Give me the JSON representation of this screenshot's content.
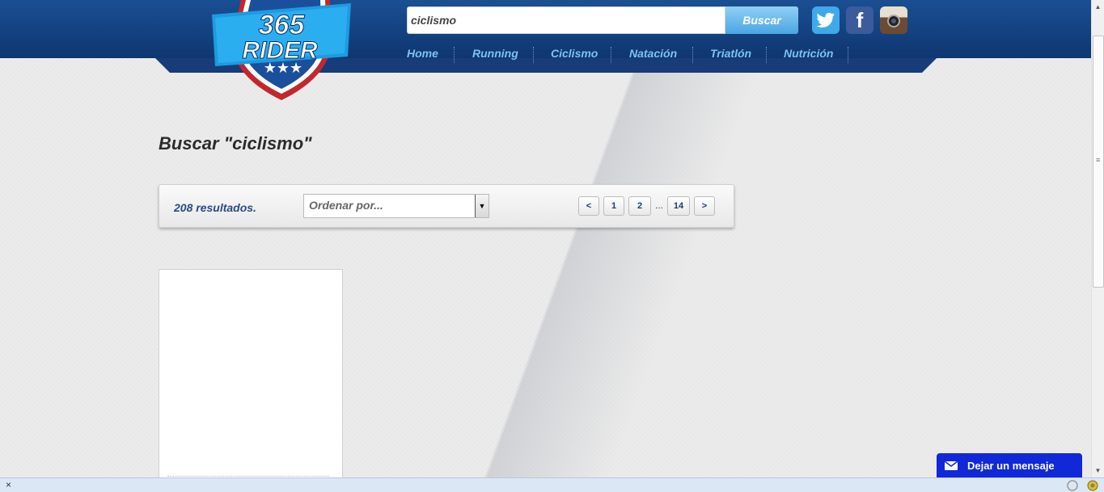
{
  "header": {
    "logo_line1": "365",
    "logo_line2": "RIDER",
    "search_value": "ciclismo",
    "search_button": "Buscar",
    "nav": [
      "Home",
      "Running",
      "Ciclismo",
      "Natación",
      "Triatlón",
      "Nutrición"
    ],
    "social": [
      "twitter-icon",
      "facebook-icon",
      "instagram-icon"
    ],
    "colors": {
      "header": "#0f3670",
      "nav_text": "#7fc2f0",
      "button": "#4aa6e3"
    }
  },
  "main": {
    "title": "Buscar \"ciclismo\"",
    "results": "208 resultados.",
    "order_placeholder": "Ordenar por...",
    "pagination": {
      "prev": "<",
      "pages": [
        "1",
        "2"
      ],
      "ellipsis": "...",
      "last": "14",
      "next": ">"
    }
  },
  "chat": {
    "label": "Dejar un mensaje",
    "color": "#1028d8"
  },
  "status_bar": {
    "close": "×"
  }
}
